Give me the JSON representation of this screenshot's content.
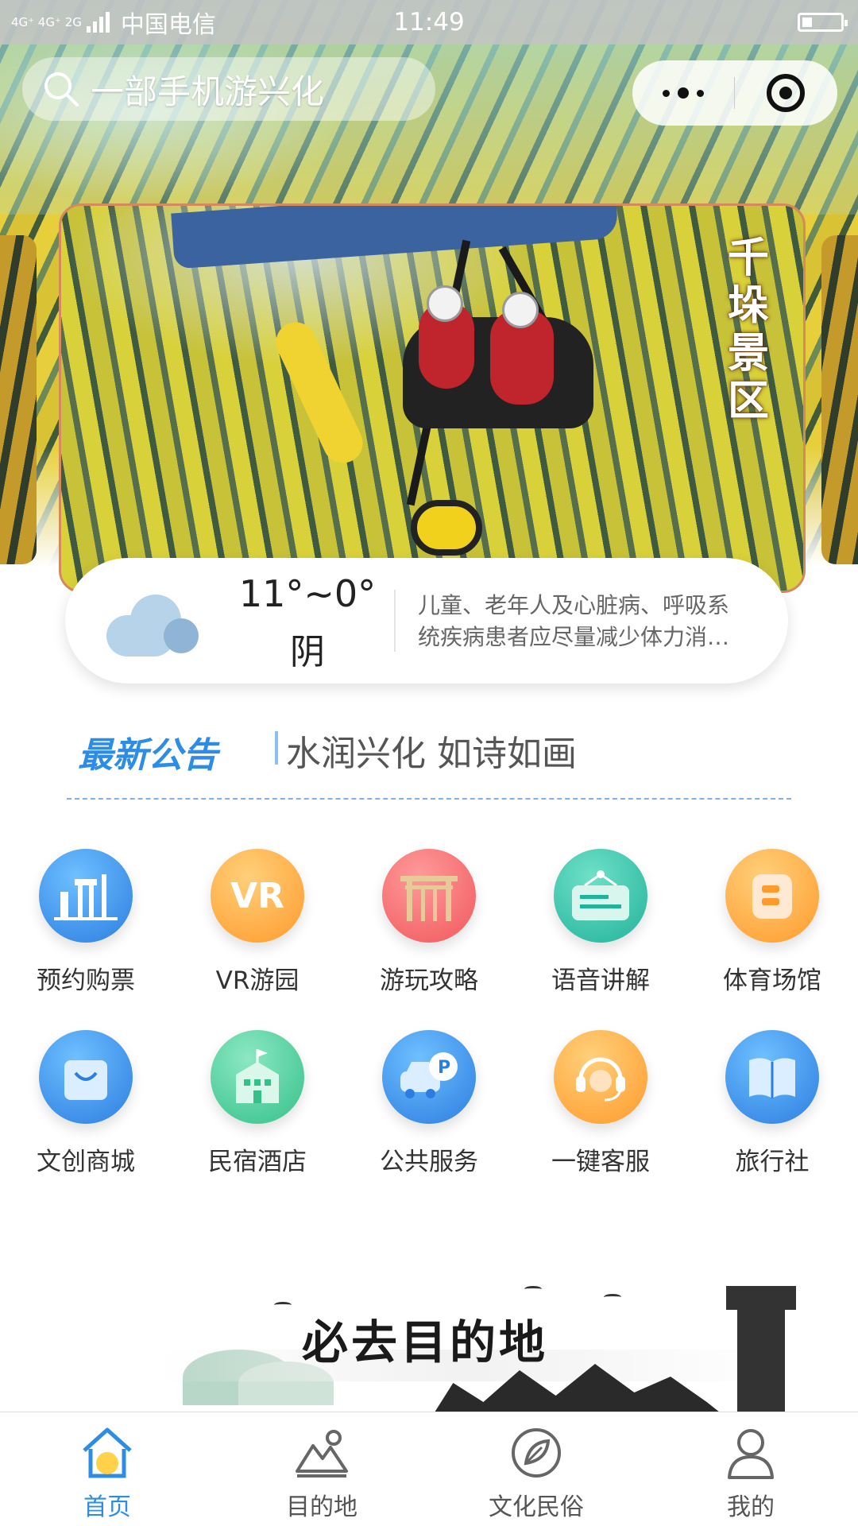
{
  "status_bar": {
    "network": "4G⁺ 4G⁺ 2G",
    "carrier": "中国电信",
    "time": "11:49"
  },
  "search": {
    "placeholder": "一部手机游兴化"
  },
  "banner": {
    "title_chars": [
      "千",
      "垛",
      "景",
      "区"
    ]
  },
  "weather": {
    "temperature": "11°~0°",
    "condition": "阴",
    "advice_line1": "儿童、老年人及心脏病、呼吸系",
    "advice_line2": "统疾病患者应尽量减少体力消…"
  },
  "notice": {
    "label": "最新公告",
    "text": "水润兴化 如诗如画"
  },
  "grid": {
    "items": [
      {
        "label": "预约购票",
        "icon": "ticket-building-icon",
        "color": "#2c7de0"
      },
      {
        "label": "VR游园",
        "icon": "vr-icon",
        "color": "#ff9a2c"
      },
      {
        "label": "游玩攻略",
        "icon": "gate-icon",
        "color": "#f0585c"
      },
      {
        "label": "语音讲解",
        "icon": "signboard-icon",
        "color": "#22b39a"
      },
      {
        "label": "体育场馆",
        "icon": "stadium-icon",
        "color": "#ff9a2c"
      },
      {
        "label": "文创商城",
        "icon": "shopping-bag-icon",
        "color": "#2c7de0"
      },
      {
        "label": "民宿酒店",
        "icon": "hotel-icon",
        "color": "#35c08a"
      },
      {
        "label": "公共服务",
        "icon": "parking-icon",
        "color": "#2c7de0"
      },
      {
        "label": "一键客服",
        "icon": "headset-icon",
        "color": "#ff9a2c"
      },
      {
        "label": "旅行社",
        "icon": "book-icon",
        "color": "#2c7de0"
      }
    ]
  },
  "destination": {
    "title": "必去目的地"
  },
  "tabbar": {
    "items": [
      {
        "label": "首页",
        "icon": "home-icon",
        "active": true
      },
      {
        "label": "目的地",
        "icon": "mountain-icon",
        "active": false
      },
      {
        "label": "文化民俗",
        "icon": "leaf-icon",
        "active": false
      },
      {
        "label": "我的",
        "icon": "user-icon",
        "active": false
      }
    ],
    "active_color": "#2d8de6"
  }
}
